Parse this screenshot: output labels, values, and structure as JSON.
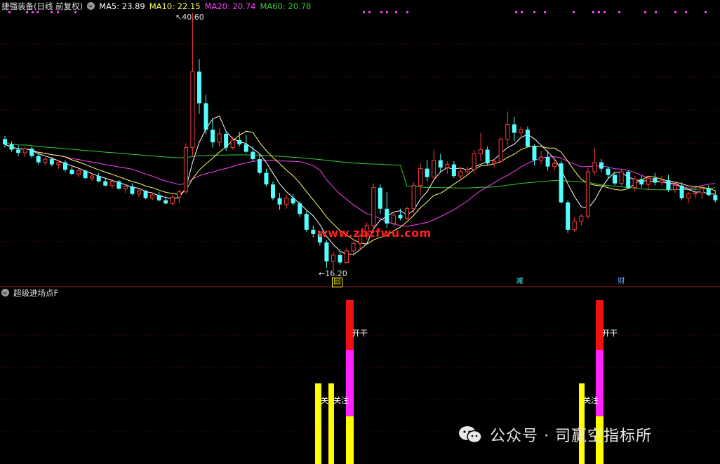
{
  "header": {
    "title": "捷强装备(日线 前复权)",
    "ma5": "MA5: 23.89",
    "ma10": "MA10: 22.15",
    "ma20": "MA20: 20.74",
    "ma60": "MA60: 20.78"
  },
  "annotations": {
    "high": "40.60",
    "low": "16.20",
    "badge_hui": "回",
    "badge_jian": "减",
    "badge_cai": "财"
  },
  "watermark": "www.zbzfwu.com",
  "indicator": {
    "title": "超级进场点F",
    "guanzhu_1": "关",
    "guanzhu_2": "关注",
    "kaigan_1": "开干",
    "guanzhu_3": "关注",
    "kaigan_2": "开干"
  },
  "footer": {
    "text": "公众号 · 司赢空指标所"
  },
  "colors": {
    "up": "#ff3b3b",
    "down": "#54ffff",
    "ma5": "#ffffff",
    "ma10": "#ffff66",
    "ma20": "#ff40ff",
    "ma60": "#33cc33",
    "signal_yellow": "#ffff00",
    "signal_magenta": "#ff22ff",
    "signal_red": "#ee1111"
  },
  "chart_data": {
    "type": "candlestick",
    "price_axis": {
      "min": 16.2,
      "max": 40.6
    },
    "candles": [
      [
        28.6,
        28.9,
        27.8,
        28.1
      ],
      [
        28.1,
        28.4,
        27.4,
        27.6
      ],
      [
        27.6,
        28.0,
        27.0,
        27.3
      ],
      [
        27.3,
        27.9,
        26.9,
        27.7
      ],
      [
        27.7,
        27.9,
        26.8,
        27.0
      ],
      [
        27.0,
        27.2,
        26.2,
        26.4
      ],
      [
        26.4,
        26.9,
        26.1,
        26.7
      ],
      [
        26.7,
        26.9,
        26.0,
        26.2
      ],
      [
        26.2,
        26.6,
        25.8,
        26.4
      ],
      [
        26.4,
        26.6,
        25.5,
        25.7
      ],
      [
        25.7,
        26.0,
        25.2,
        25.3
      ],
      [
        25.3,
        25.8,
        25.0,
        25.6
      ],
      [
        25.6,
        25.7,
        24.8,
        24.9
      ],
      [
        24.9,
        25.3,
        24.6,
        25.1
      ],
      [
        25.1,
        25.4,
        24.5,
        24.6
      ],
      [
        24.6,
        24.9,
        24.1,
        24.2
      ],
      [
        24.2,
        24.8,
        23.9,
        24.6
      ],
      [
        24.6,
        24.7,
        23.8,
        23.9
      ],
      [
        23.9,
        24.3,
        23.5,
        24.1
      ],
      [
        24.1,
        24.4,
        23.3,
        23.4
      ],
      [
        23.4,
        23.9,
        23.1,
        23.7
      ],
      [
        23.7,
        23.8,
        22.9,
        23.0
      ],
      [
        23.0,
        23.5,
        22.8,
        23.3
      ],
      [
        23.3,
        23.6,
        22.7,
        22.8
      ],
      [
        22.8,
        23.2,
        22.4,
        22.5
      ],
      [
        22.5,
        23.3,
        22.3,
        23.1
      ],
      [
        23.1,
        23.8,
        22.5,
        23.6
      ],
      [
        23.6,
        28.2,
        23.4,
        27.8
      ],
      [
        27.8,
        40.6,
        27.0,
        35.0
      ],
      [
        35.0,
        36.2,
        31.0,
        32.0
      ],
      [
        32.0,
        32.8,
        29.0,
        29.5
      ],
      [
        29.5,
        30.5,
        27.8,
        28.3
      ],
      [
        28.3,
        29.6,
        27.9,
        29.1
      ],
      [
        29.1,
        29.4,
        27.5,
        27.8
      ],
      [
        27.8,
        28.8,
        27.6,
        28.5
      ],
      [
        28.5,
        29.3,
        27.9,
        28.1
      ],
      [
        28.1,
        29.0,
        27.3,
        27.4
      ],
      [
        27.4,
        27.9,
        26.5,
        26.7
      ],
      [
        26.7,
        27.2,
        25.2,
        25.4
      ],
      [
        25.4,
        25.8,
        24.1,
        24.3
      ],
      [
        24.3,
        24.6,
        22.8,
        23.0
      ],
      [
        23.0,
        23.5,
        21.9,
        22.4
      ],
      [
        22.4,
        23.3,
        22.0,
        23.0
      ],
      [
        23.0,
        23.4,
        22.3,
        22.5
      ],
      [
        22.5,
        22.7,
        21.2,
        21.5
      ],
      [
        21.5,
        21.8,
        19.8,
        20.0
      ],
      [
        20.0,
        20.4,
        19.3,
        19.6
      ],
      [
        19.6,
        19.9,
        18.5,
        18.8
      ],
      [
        18.8,
        19.0,
        16.4,
        17.0
      ],
      [
        17.0,
        17.9,
        16.2,
        17.6
      ],
      [
        17.6,
        17.9,
        16.7,
        16.9
      ],
      [
        16.9,
        18.3,
        16.8,
        18.0
      ],
      [
        18.0,
        18.9,
        17.5,
        18.7
      ],
      [
        18.7,
        19.6,
        18.2,
        19.4
      ],
      [
        19.4,
        20.7,
        19.1,
        20.4
      ],
      [
        20.4,
        24.4,
        20.0,
        24.0
      ],
      [
        24.0,
        24.3,
        21.5,
        22.0
      ],
      [
        22.0,
        23.6,
        20.2,
        20.6
      ],
      [
        20.6,
        21.7,
        20.3,
        21.4
      ],
      [
        21.4,
        22.0,
        20.9,
        21.1
      ],
      [
        21.1,
        22.2,
        20.9,
        22.0
      ],
      [
        22.0,
        24.5,
        21.6,
        24.2
      ],
      [
        24.2,
        26.3,
        23.3,
        25.8
      ],
      [
        25.8,
        26.6,
        24.6,
        25.0
      ],
      [
        25.0,
        27.6,
        24.7,
        26.6
      ],
      [
        26.6,
        27.2,
        25.4,
        25.9
      ],
      [
        25.9,
        26.5,
        25.3,
        26.2
      ],
      [
        26.2,
        26.5,
        24.9,
        25.1
      ],
      [
        25.1,
        25.9,
        24.7,
        25.5
      ],
      [
        25.5,
        26.0,
        25.2,
        25.7
      ],
      [
        25.7,
        27.6,
        25.3,
        27.2
      ],
      [
        27.2,
        29.2,
        26.5,
        27.6
      ],
      [
        27.6,
        27.9,
        26.1,
        26.3
      ],
      [
        26.3,
        26.7,
        25.9,
        26.5
      ],
      [
        26.5,
        28.8,
        26.4,
        28.6
      ],
      [
        28.6,
        31.2,
        28.0,
        30.0
      ],
      [
        30.0,
        30.7,
        28.4,
        29.2
      ],
      [
        29.2,
        29.8,
        28.7,
        29.5
      ],
      [
        29.5,
        29.8,
        27.8,
        27.9
      ],
      [
        27.9,
        28.1,
        26.1,
        26.6
      ],
      [
        26.6,
        27.5,
        26.2,
        26.9
      ],
      [
        26.9,
        27.5,
        25.6,
        26.0
      ],
      [
        26.0,
        26.7,
        25.6,
        26.3
      ],
      [
        26.3,
        26.5,
        22.5,
        22.6
      ],
      [
        22.6,
        22.8,
        19.7,
        20.0
      ],
      [
        20.0,
        21.2,
        19.8,
        20.8
      ],
      [
        20.8,
        21.5,
        20.4,
        21.3
      ],
      [
        21.3,
        25.9,
        21.0,
        25.5
      ],
      [
        25.5,
        27.8,
        25.2,
        26.4
      ],
      [
        26.4,
        26.7,
        25.5,
        25.8
      ],
      [
        25.8,
        26.0,
        24.9,
        25.2
      ],
      [
        25.2,
        25.4,
        24.2,
        24.4
      ],
      [
        24.4,
        25.7,
        24.2,
        25.5
      ],
      [
        25.5,
        25.6,
        23.9,
        24.0
      ],
      [
        24.0,
        25.1,
        23.7,
        24.8
      ],
      [
        24.8,
        25.1,
        24.0,
        24.3
      ],
      [
        24.3,
        25.1,
        23.7,
        24.9
      ],
      [
        24.9,
        25.4,
        24.2,
        24.5
      ],
      [
        24.5,
        25.1,
        24.2,
        24.7
      ],
      [
        24.7,
        25.2,
        23.6,
        23.8
      ],
      [
        23.8,
        24.6,
        23.5,
        24.2
      ],
      [
        24.2,
        24.5,
        22.8,
        23.0
      ],
      [
        23.0,
        23.6,
        22.5,
        23.4
      ],
      [
        23.4,
        24.0,
        23.0,
        23.5
      ],
      [
        23.5,
        24.1,
        22.9,
        23.9
      ],
      [
        23.9,
        24.2,
        23.2,
        23.3
      ],
      [
        23.3,
        23.7,
        22.6,
        22.8
      ]
    ],
    "ma_series": [
      "MA5",
      "MA10",
      "MA20",
      "MA60"
    ],
    "signals": [
      {
        "bar": 91,
        "type": "关注"
      },
      {
        "bar": 93,
        "type": "关注"
      },
      {
        "bar": 95,
        "type": "开干"
      },
      {
        "bar": 161,
        "type": "关注"
      },
      {
        "bar": 164,
        "type": "开干"
      }
    ]
  }
}
